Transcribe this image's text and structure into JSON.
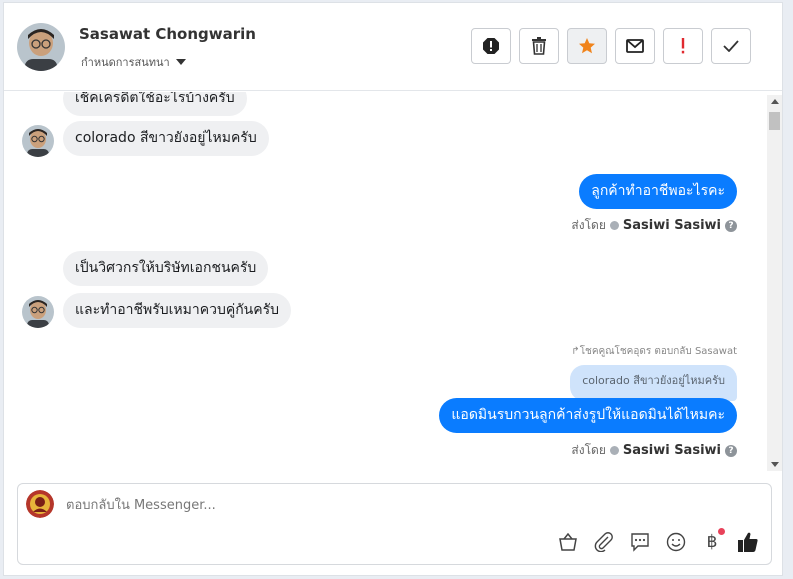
{
  "header": {
    "contact_name": "Sasawat Chongwarin",
    "assign_label": "กำหนดการสนทนา",
    "actions": [
      "report-icon",
      "trash-icon",
      "star-icon",
      "envelope-icon",
      "exclamation-icon",
      "check-icon"
    ],
    "colors": {
      "star": "#f0841c",
      "exclamation": "#e0292f"
    }
  },
  "messages": {
    "in_1": "เช็คเครดิตใช้อะไรบ้างครับ",
    "in_2": "colorado สีขาวยังอยู่ไหมครับ",
    "out_1": "ลูกค้าทำอาชีพอะไรคะ",
    "sent_by_1": {
      "prefix": "ส่งโดย",
      "name": "Sasiwi Sasiwi"
    },
    "in_3": "เป็นวิศวกรให้บริษัทเอกชนครับ",
    "in_4": "และทำอาชีพรับเหมาควบคู่กันครับ",
    "reply_note": "โชคคูณโชคอุดร ตอบกลับ Sasawat",
    "quote": "colorado สีขาวยังอยู่ไหมครับ",
    "out_2": "แอดมินรบกวนลูกค้าส่งรูปให้แอดมินได้ไหมคะ",
    "sent_by_2": {
      "prefix": "ส่งโดย",
      "name": "Sasiwi Sasiwi"
    }
  },
  "composer": {
    "placeholder": "ตอบกลับใน Messenger...",
    "tools": [
      "basket-icon",
      "paperclip-icon",
      "chat-bubble-icon",
      "smiley-icon",
      "baht-icon",
      "thumbs-up-icon"
    ],
    "baht_symbol": "฿",
    "accent": "#0a7cff"
  }
}
